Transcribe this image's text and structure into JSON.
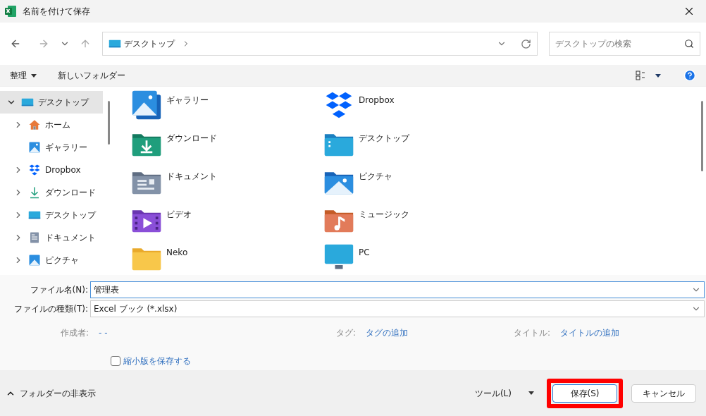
{
  "window": {
    "title": "名前を付けて保存"
  },
  "nav": {
    "address": "デスクトップ",
    "search": {
      "placeholder": "デスクトップの検索"
    }
  },
  "toolbar": {
    "organize": "整理",
    "new_folder": "新しいフォルダー"
  },
  "sidebar": {
    "items": [
      {
        "label": "デスクトップ",
        "kind": "desktop",
        "selected": true,
        "expandable": true,
        "expanded": true,
        "children": [
          {
            "label": "ホーム",
            "kind": "home",
            "selected": false,
            "expandable": true,
            "expanded": false
          },
          {
            "label": "ギャラリー",
            "kind": "gallery",
            "selected": false,
            "expandable": false,
            "expanded": false
          },
          {
            "label": "Dropbox",
            "kind": "dropbox",
            "selected": false,
            "expandable": true,
            "expanded": false
          },
          {
            "label": "ダウンロード",
            "kind": "download",
            "selected": false,
            "expandable": true,
            "expanded": false
          },
          {
            "label": "デスクトップ",
            "kind": "desktop",
            "selected": false,
            "expandable": true,
            "expanded": false
          },
          {
            "label": "ドキュメント",
            "kind": "document",
            "selected": false,
            "expandable": true,
            "expanded": false
          },
          {
            "label": "ピクチャ",
            "kind": "picture",
            "selected": false,
            "expandable": true,
            "expanded": false
          }
        ]
      }
    ]
  },
  "content": {
    "items": [
      {
        "label": "ギャラリー",
        "kind": "gallery"
      },
      {
        "label": "Dropbox",
        "kind": "dropbox"
      },
      {
        "label": "ダウンロード",
        "kind": "download"
      },
      {
        "label": "デスクトップ",
        "kind": "desktop"
      },
      {
        "label": "ドキュメント",
        "kind": "document"
      },
      {
        "label": "ピクチャ",
        "kind": "picture"
      },
      {
        "label": "ビデオ",
        "kind": "video"
      },
      {
        "label": "ミュージック",
        "kind": "music"
      },
      {
        "label": "Neko",
        "kind": "folder"
      },
      {
        "label": "PC",
        "kind": "pc"
      }
    ]
  },
  "form": {
    "file_name": {
      "label": "ファイル名(N):",
      "value": "管理表"
    },
    "file_type": {
      "label": "ファイルの種類(T):",
      "value": "Excel ブック (*.xlsx)"
    },
    "metadata": [
      {
        "label": "作成者:",
        "value": "- -"
      },
      {
        "label": "タグ:",
        "value": "タグの追加"
      },
      {
        "label": "タイトル:",
        "value": "タイトルの追加"
      }
    ],
    "thumbnail": {
      "label": "縮小版を保存する",
      "checked": false
    }
  },
  "footer": {
    "hide_folders": "フォルダーの非表示",
    "tools": "ツール(L)",
    "buttons": [
      {
        "label": "保存(S)",
        "kind": "primary",
        "highlighted": true
      },
      {
        "label": "キャンセル",
        "kind": "secondary",
        "highlighted": false
      }
    ]
  }
}
